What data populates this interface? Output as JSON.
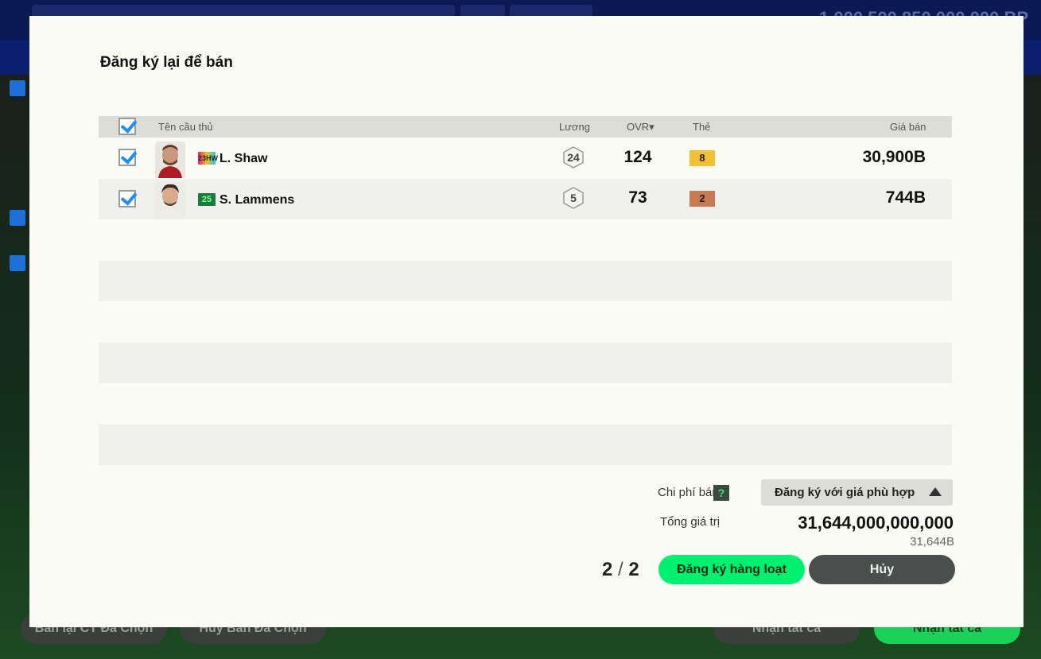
{
  "modal": {
    "title": "Đăng ký lại để bán",
    "columns": {
      "name": "Tên cầu thủ",
      "wage": "Lương",
      "ovr": "OVR▾",
      "card": "Thẻ",
      "price": "Giá bán"
    },
    "rows": [
      {
        "season": "23HW",
        "name": "L. Shaw",
        "wage": "24",
        "ovr": "124",
        "grade": "8",
        "price": "30,900B",
        "grade_color": "#f2c232"
      },
      {
        "season": "25",
        "name": "S. Lammens",
        "wage": "5",
        "ovr": "73",
        "grade": "2",
        "price": "744B",
        "grade_color": "#c97a52"
      }
    ],
    "fee_label": "Chi phí bán",
    "fee_help": "?",
    "dropdown_label": "Đăng ký với giá phù hợp",
    "total_label": "Tổng giá trị",
    "total_value": "31,644,000,000,000",
    "total_short": "31,644B",
    "selected_count": "2",
    "total_count": "2",
    "register_button": "Đăng ký hàng loạt",
    "cancel_button": "Hủy"
  },
  "background": {
    "balance": "1,000,500,850,000,000 BP",
    "bottom_buttons": [
      "Bán lại CT Đã Chọn",
      "Hủy Bán Đã Chọn",
      "Nhận tất cả",
      "Nhận tất cả"
    ]
  }
}
